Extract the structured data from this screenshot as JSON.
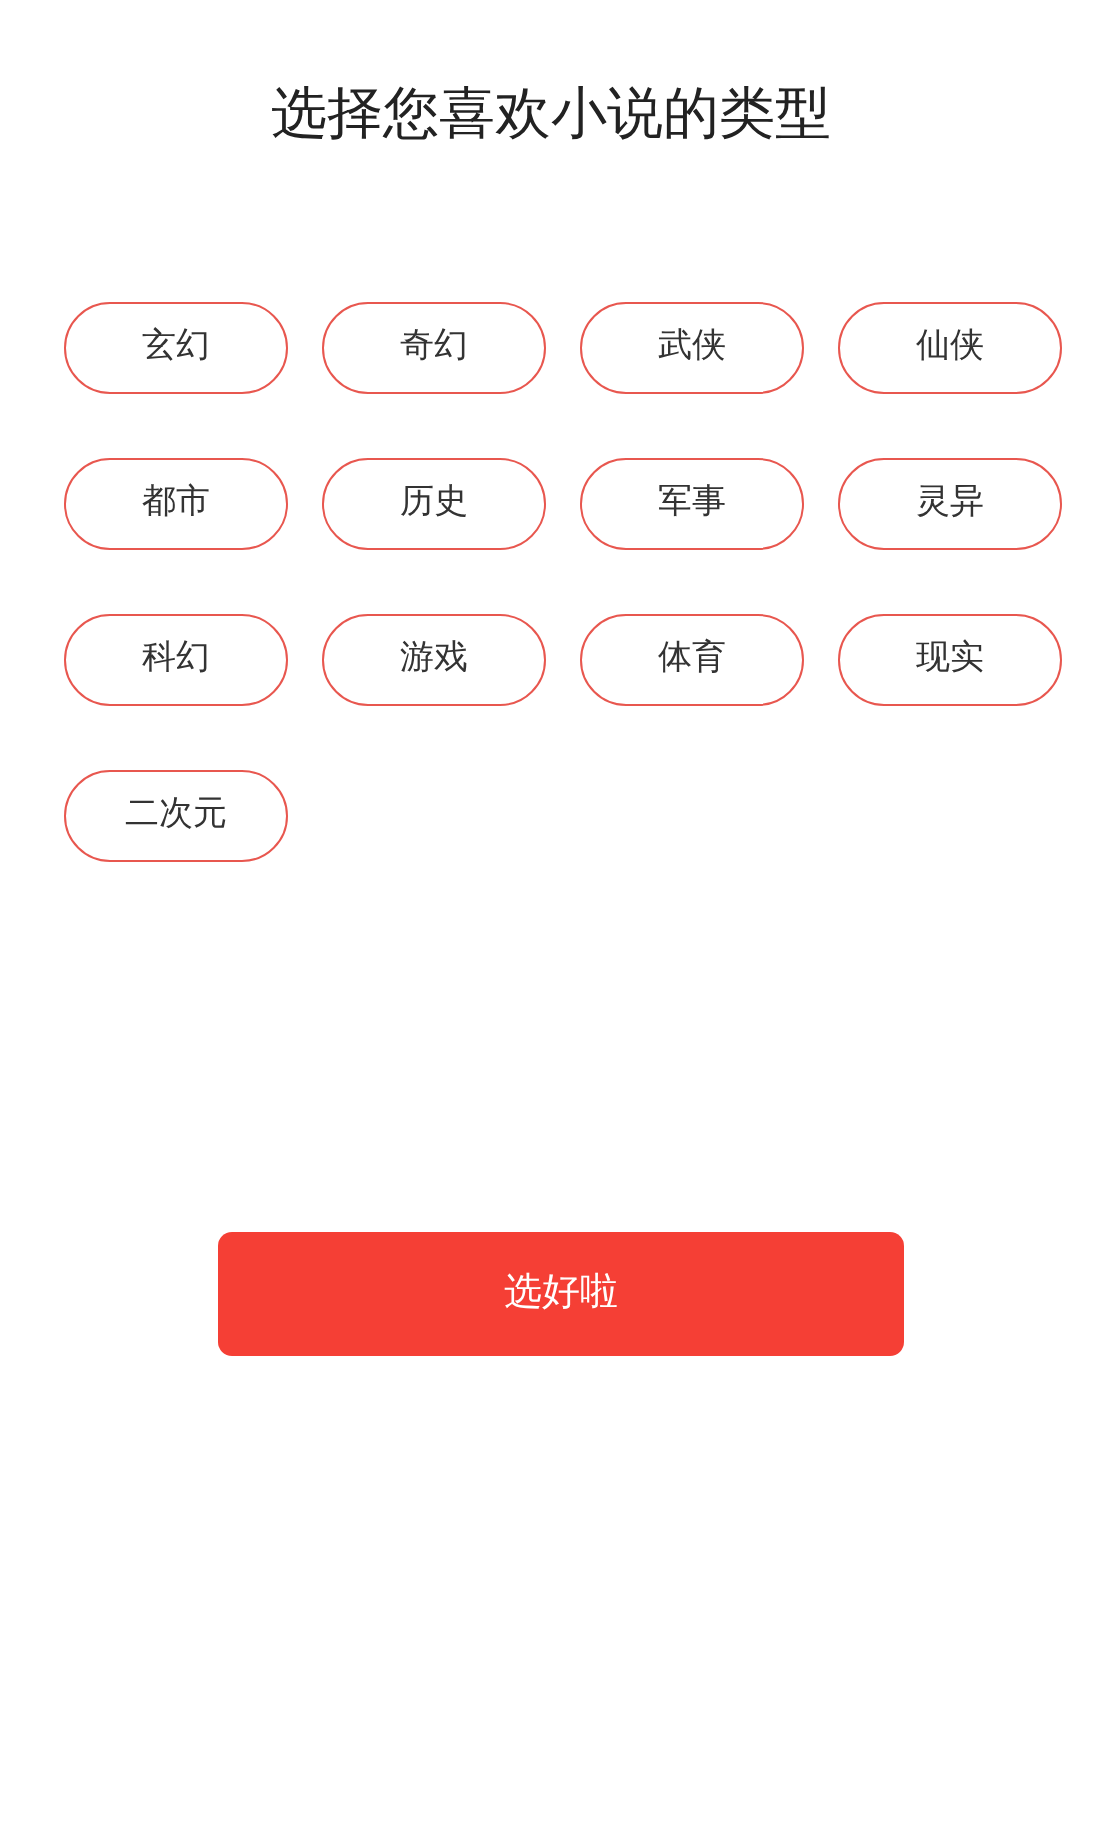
{
  "title": "选择您喜欢小说的类型",
  "genres": [
    {
      "label": "玄幻",
      "selected": false
    },
    {
      "label": "奇幻",
      "selected": false
    },
    {
      "label": "武侠",
      "selected": false
    },
    {
      "label": "仙侠",
      "selected": false
    },
    {
      "label": "都市",
      "selected": false
    },
    {
      "label": "历史",
      "selected": false
    },
    {
      "label": "军事",
      "selected": false
    },
    {
      "label": "灵异",
      "selected": false
    },
    {
      "label": "科幻",
      "selected": false
    },
    {
      "label": "游戏",
      "selected": false
    },
    {
      "label": "体育",
      "selected": false
    },
    {
      "label": "现实",
      "selected": false
    },
    {
      "label": "二次元",
      "selected": false
    }
  ],
  "confirm_button": "选好啦"
}
